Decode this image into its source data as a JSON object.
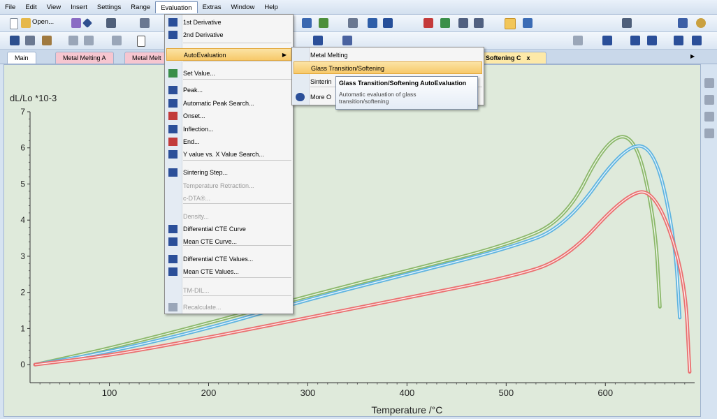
{
  "menubar": [
    "File",
    "Edit",
    "View",
    "Insert",
    "Settings",
    "Range",
    "Evaluation",
    "Extras",
    "Window",
    "Help"
  ],
  "toolbar": {
    "open_label": "Open..."
  },
  "tabs": [
    "Main",
    "Metal Melting A",
    "Metal Melt",
    "Softening C"
  ],
  "evaluation_menu": {
    "items": [
      "1st Derivative",
      "2nd Derivative",
      "AutoEvaluation",
      "Set Value...",
      "Peak...",
      "Automatic Peak Search...",
      "Onset...",
      "Inflection...",
      "End...",
      "Y value vs. X Value Search...",
      "Sintering Step...",
      "Temperature Retraction...",
      "c-DTA®...",
      "Density...",
      "Differential CTE Curve",
      "Mean CTE Curve...",
      "Differential CTE Values...",
      "Mean CTE Values...",
      "TM-DIL...",
      "Recalculate..."
    ]
  },
  "autoeval_menu": {
    "items": [
      "Metal Melting",
      "Glass Transition/Softening",
      "Sinterin",
      "More O"
    ]
  },
  "tooltip": {
    "title": "Glass Transition/Softening AutoEvaluation",
    "desc": "Automatic evaluation of glass transition/softening"
  },
  "chart_data": {
    "type": "line",
    "ylabel": "dL/Lo *10-3",
    "xlabel": "Temperature /°C",
    "xticks": [
      100,
      200,
      300,
      400,
      500,
      600
    ],
    "yticks": [
      0,
      1,
      2,
      3,
      4,
      5,
      6,
      7
    ],
    "xlim": [
      20,
      690
    ],
    "ylim": [
      -0.5,
      7
    ],
    "series": [
      {
        "color": "#8bb86a",
        "x": [
          25,
          100,
          200,
          300,
          400,
          500,
          560,
          600,
          630,
          650,
          655
        ],
        "y": [
          0.0,
          0.45,
          1.15,
          1.9,
          2.6,
          3.3,
          4.0,
          6.2,
          6.4,
          4.0,
          1.6
        ]
      },
      {
        "color": "#5fb4e0",
        "x": [
          25,
          100,
          200,
          300,
          400,
          500,
          560,
          620,
          650,
          670,
          675
        ],
        "y": [
          0.0,
          0.35,
          1.0,
          1.8,
          2.5,
          3.2,
          3.8,
          6.1,
          6.0,
          3.5,
          1.3
        ]
      },
      {
        "color": "#ea6f6f",
        "x": [
          25,
          100,
          200,
          300,
          400,
          500,
          560,
          620,
          650,
          680,
          685
        ],
        "y": [
          0.0,
          0.25,
          0.75,
          1.3,
          1.85,
          2.4,
          2.9,
          4.7,
          4.85,
          2.5,
          -0.2
        ]
      }
    ]
  }
}
